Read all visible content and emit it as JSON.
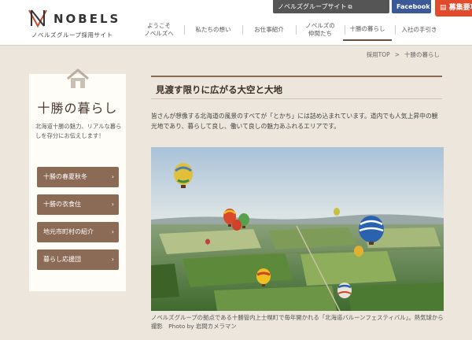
{
  "header": {
    "logo_word": "NOBELS",
    "logo_sub": "ノベルズグループ採用サイト",
    "top_buttons": {
      "group_site": "ノベルズグループサイト",
      "facebook": "Facebook",
      "recruit": "募集要項"
    },
    "nav": [
      {
        "line1": "ようこそ",
        "line2": "ノベルズへ"
      },
      {
        "line1": "私たちの想い",
        "line2": ""
      },
      {
        "line1": "お仕事紹介",
        "line2": ""
      },
      {
        "line1": "ノベルズの",
        "line2": "仲間たち"
      },
      {
        "line1": "十勝の暮らし",
        "line2": ""
      },
      {
        "line1": "入社の手引き",
        "line2": ""
      }
    ]
  },
  "breadcrumb": {
    "home": "採用TOP",
    "sep": ">",
    "current": "十勝の暮らし"
  },
  "sidebar": {
    "title": "十勝の暮らし",
    "description": "北海道十勝の魅力、リアルな暮らしを存分にお伝えします！",
    "items": [
      {
        "label": "十勝の春夏秋冬"
      },
      {
        "label": "十勝の衣食住"
      },
      {
        "label": "地元市町村の紹介"
      },
      {
        "label": "暮らし応援団"
      }
    ],
    "arrow": "›"
  },
  "main": {
    "title": "見渡す限りに広がる大空と大地",
    "text": "皆さんが想像する北海道の風景のすべてが「とかち」には詰め込まれています。道内でも人気上昇中の観光地であり、暮らして良し、働いて良しの魅力あふれるエリアです。",
    "caption": "ノベルズグループの拠点である十勝管内上士幌町で毎年開かれる「北海道バルーンフェスティバル」。熱気球から撮影　Photo by 岩間カメラマン"
  },
  "colors": {
    "accent_brown": "#8b6a56",
    "recruit_red": "#e14b2c",
    "facebook_blue": "#3b5998",
    "background": "#ece6dc"
  }
}
